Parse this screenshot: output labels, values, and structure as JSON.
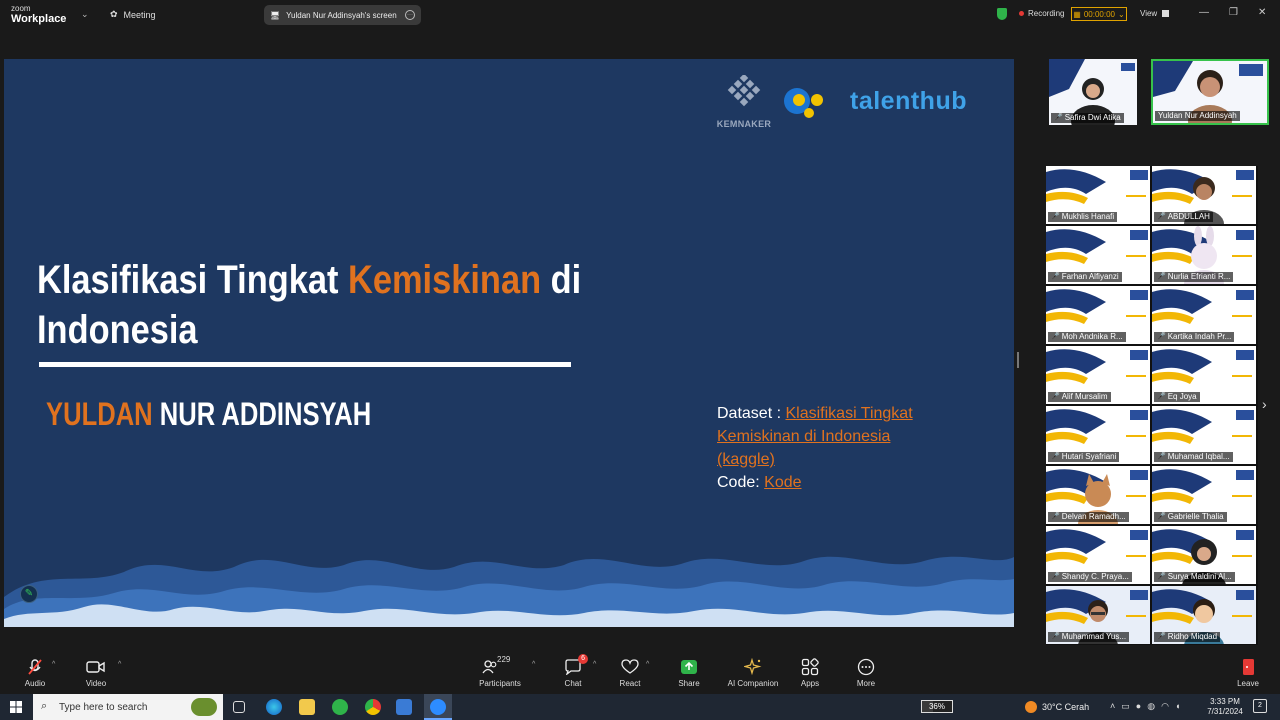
{
  "app": {
    "brand_small": "zoom",
    "brand_big": "Workplace",
    "meeting_label": "Meeting",
    "screen_pill": "Yuldan Nur Addinsyah's screen",
    "recording_label": "Recording",
    "timer": "00:00:00",
    "view_label": "View"
  },
  "slide": {
    "logo_kemnaker": "KEMNAKER",
    "logo_talenthub": "talenthub",
    "title_part1": "Klasifikasi Tingkat ",
    "title_highlight": "Kemiskinan",
    "title_part2": " di",
    "title_line2": "Indonesia",
    "author_highlight": "YULDAN",
    "author_rest": " NUR ADDINSYAH",
    "dataset_label": "Dataset : ",
    "dataset_link": "Klasifikasi Tingkat Kemiskinan di Indonesia (kaggle)",
    "code_label": "Code: ",
    "code_link": "Kode"
  },
  "speakers": [
    {
      "name": "Safira Dwi Atika"
    },
    {
      "name": "Yuldan Nur Addinsyah"
    }
  ],
  "gallery": [
    {
      "name": "Mukhlis Hanafi"
    },
    {
      "name": "ABDULLAH"
    },
    {
      "name": "Farhan Alfiyanzi"
    },
    {
      "name": "Nurlia Efrianti R..."
    },
    {
      "name": "Moh Andnika R..."
    },
    {
      "name": "Kartika Indah Pr..."
    },
    {
      "name": "Alif Mursalim"
    },
    {
      "name": "Eq Joya"
    },
    {
      "name": "Hutari Syafriani"
    },
    {
      "name": "Muhamad Iqbal..."
    },
    {
      "name": "Delvan Ramadh..."
    },
    {
      "name": "Gabrielle Thalia"
    },
    {
      "name": "Shandy C. Praya..."
    },
    {
      "name": "Surya Maldini Al..."
    },
    {
      "name": "Muhammad Yus..."
    },
    {
      "name": "Ridho Miqdad"
    }
  ],
  "controls": {
    "audio": "Audio",
    "video": "Video",
    "participants": "Participants",
    "participants_count": "229",
    "chat": "Chat",
    "chat_badge": "6",
    "react": "React",
    "share": "Share",
    "ai_companion": "AI Companion",
    "apps": "Apps",
    "more": "More",
    "leave": "Leave"
  },
  "taskbar": {
    "search_placeholder": "Type here to search",
    "battery": "36%",
    "weather": "30°C  Cerah",
    "time": "3:33 PM",
    "date": "7/31/2024",
    "notifications": "2"
  },
  "colors": {
    "slide_bg": "#1e3861",
    "accent_orange": "#e0721f",
    "talenthub_blue": "#3fa2e8",
    "active_speaker": "#37c24b",
    "recording_red": "#e53935",
    "share_green": "#2fb34a"
  }
}
